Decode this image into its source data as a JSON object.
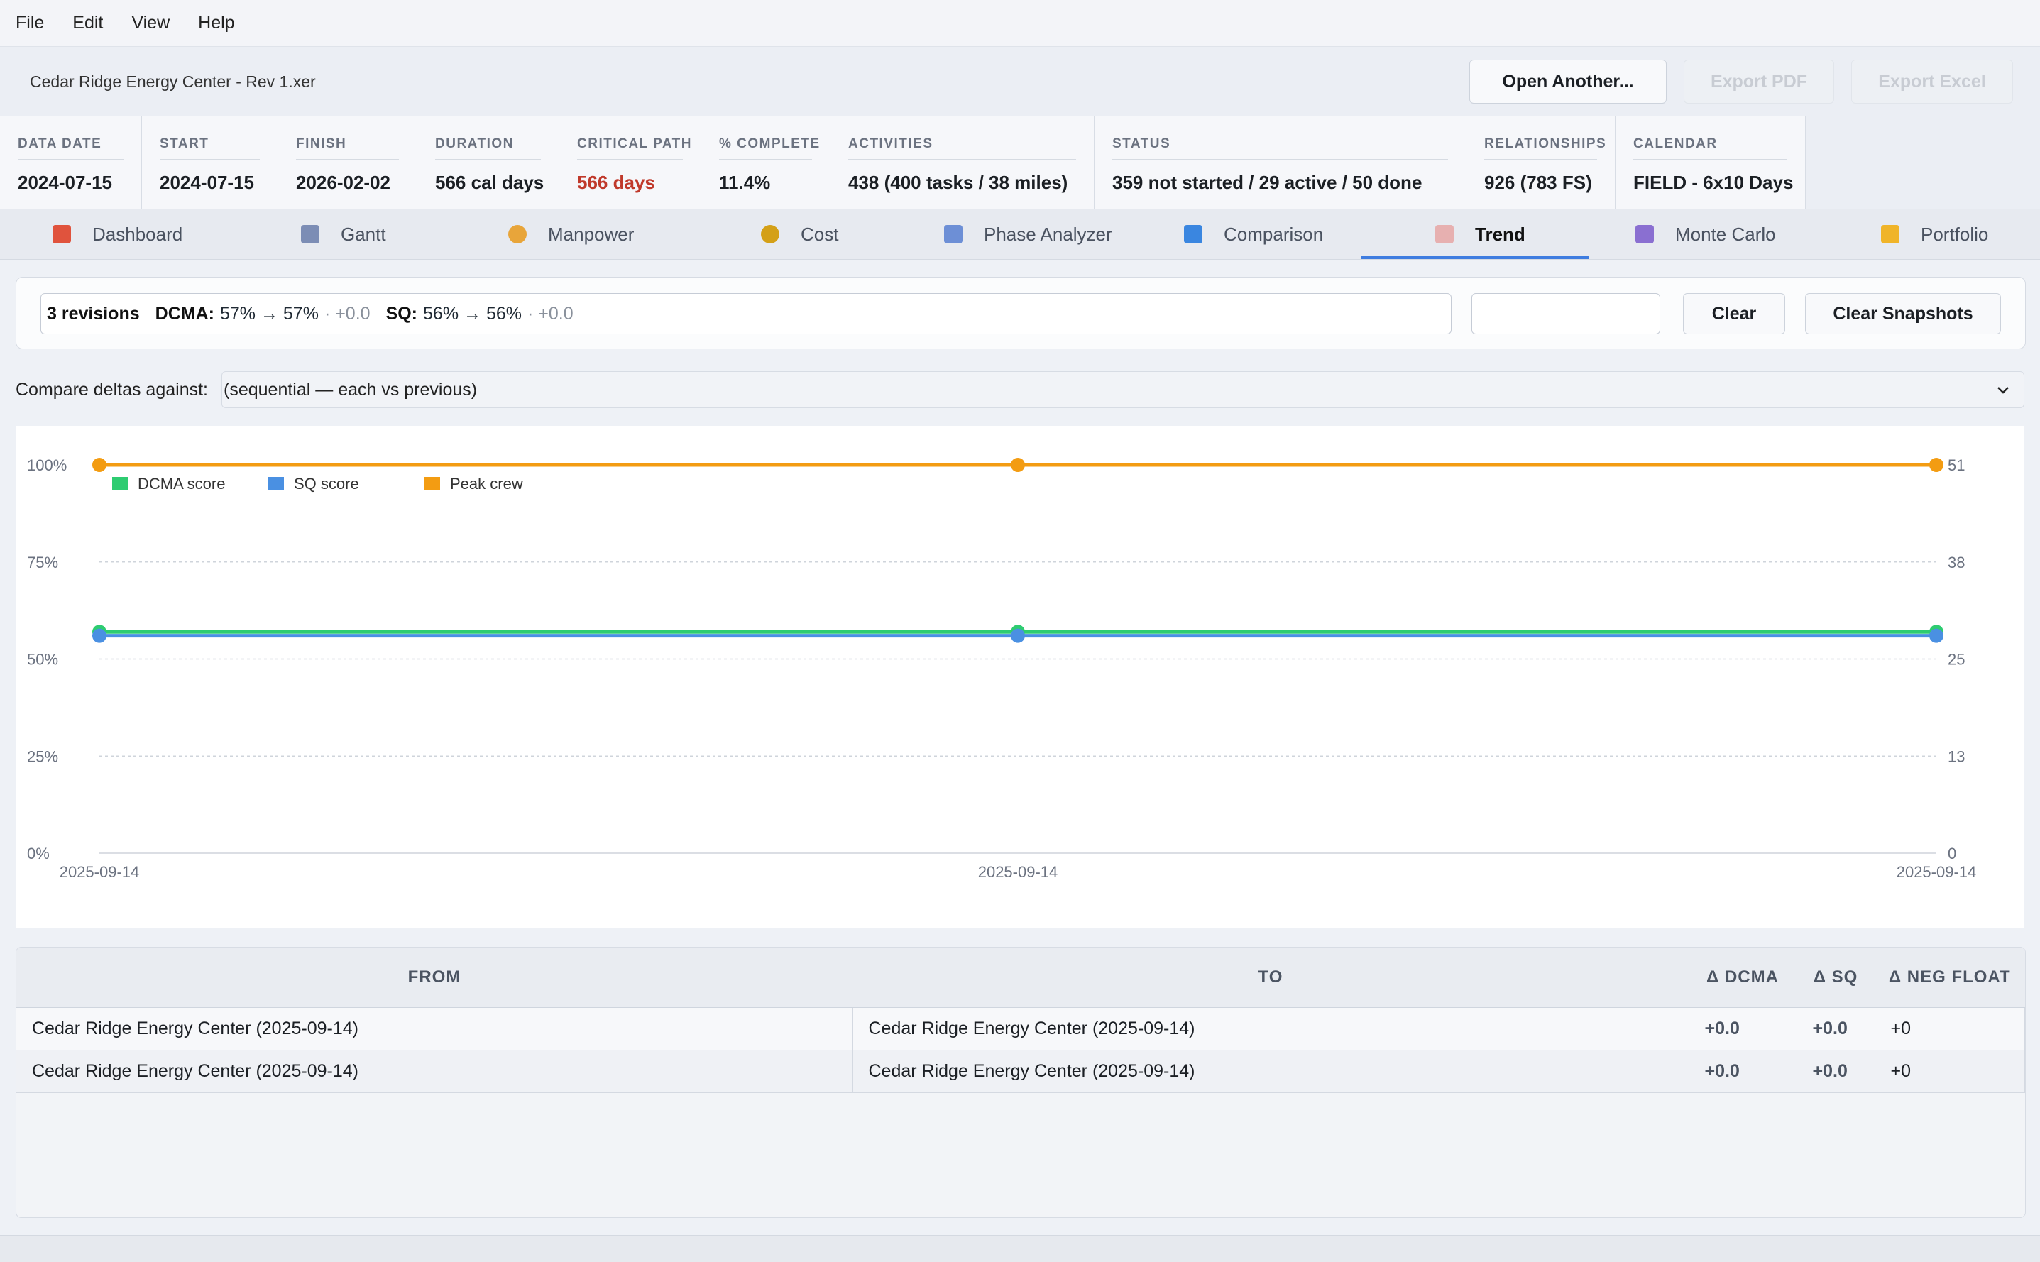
{
  "menu": [
    "File",
    "Edit",
    "View",
    "Help"
  ],
  "file": {
    "name": "Cedar Ridge Energy Center - Rev 1.xer",
    "open_label": "Open Another...",
    "export_pdf_label": "Export PDF",
    "export_excel_label": "Export Excel"
  },
  "summary": [
    {
      "label": "DATA DATE",
      "value": "2024-07-15"
    },
    {
      "label": "START",
      "value": "2024-07-15"
    },
    {
      "label": "FINISH",
      "value": "2026-02-02"
    },
    {
      "label": "DURATION",
      "value": "566 cal days"
    },
    {
      "label": "CRITICAL PATH",
      "value": "566 days",
      "accent": "#c0392b"
    },
    {
      "label": "% COMPLETE",
      "value": "11.4%"
    },
    {
      "label": "ACTIVITIES",
      "value": "438  (400 tasks / 38 miles)"
    },
    {
      "label": "STATUS",
      "value": "359 not started  /  29 active  /  50 done"
    },
    {
      "label": "RELATIONSHIPS",
      "value": "926  (783 FS)"
    },
    {
      "label": "CALENDAR",
      "value": "FIELD - 6x10 Days"
    }
  ],
  "tabs": [
    {
      "label": "Dashboard",
      "icon": "bar-chart-icon",
      "color": "#e0533d"
    },
    {
      "label": "Gantt",
      "icon": "line-chart-icon",
      "color": "#7c8db5"
    },
    {
      "label": "Manpower",
      "icon": "worker-icon",
      "color": "#e8a53a"
    },
    {
      "label": "Cost",
      "icon": "money-bag-icon",
      "color": "#d4a017"
    },
    {
      "label": "Phase Analyzer",
      "icon": "calendar-icon",
      "color": "#6d8fd6"
    },
    {
      "label": "Comparison",
      "icon": "shuffle-icon",
      "color": "#3a86e0"
    },
    {
      "label": "Trend",
      "icon": "trend-down-icon",
      "color": "#d9534f",
      "active": true
    },
    {
      "label": "Monte Carlo",
      "icon": "dice-icon",
      "color": "#8a6fd1"
    },
    {
      "label": "Portfolio",
      "icon": "folder-icon",
      "color": "#f0b429"
    }
  ],
  "snapshot": {
    "revisions": "3 revisions",
    "dcma_label": "DCMA:",
    "dcma_value": "57% → 57%",
    "dcma_delta": "· +0.0",
    "sq_label": "SQ:",
    "sq_value": "56% → 56%",
    "sq_delta": "· +0.0",
    "name_placeholder": "",
    "clear_label": "Clear",
    "clear_snapshots_label": "Clear Snapshots"
  },
  "compare": {
    "label": "Compare deltas against:",
    "selected": "(sequential — each vs previous)"
  },
  "chart_data": {
    "type": "line",
    "x": [
      "2025-09-14",
      "2025-09-14",
      "2025-09-14"
    ],
    "left_axis": {
      "ticks": [
        "0%",
        "25%",
        "50%",
        "75%",
        "100%"
      ],
      "ylim": [
        0,
        100
      ]
    },
    "right_axis": {
      "ticks": [
        "0",
        "13",
        "25",
        "38",
        "51"
      ],
      "ylim": [
        0,
        51
      ]
    },
    "grid": true,
    "legend": "top-left",
    "series": [
      {
        "name": "DCMA score",
        "axis": "left",
        "values": [
          57,
          57,
          57
        ],
        "color": "#2ecc71"
      },
      {
        "name": "SQ score",
        "axis": "left",
        "values": [
          56,
          56,
          56
        ],
        "color": "#4a90e2"
      },
      {
        "name": "Peak crew",
        "axis": "right",
        "values": [
          51,
          51,
          51
        ],
        "color": "#f39c12"
      }
    ]
  },
  "table": {
    "headers": [
      "FROM",
      "TO",
      "Δ DCMA",
      "Δ SQ",
      "Δ NEG FLOAT"
    ],
    "rows": [
      [
        "Cedar Ridge Energy Center (2025-09-14)",
        "Cedar Ridge Energy Center (2025-09-14)",
        "+0.0",
        "+0.0",
        "+0"
      ],
      [
        "Cedar Ridge Energy Center (2025-09-14)",
        "Cedar Ridge Energy Center (2025-09-14)",
        "+0.0",
        "+0.0",
        "+0"
      ]
    ]
  }
}
